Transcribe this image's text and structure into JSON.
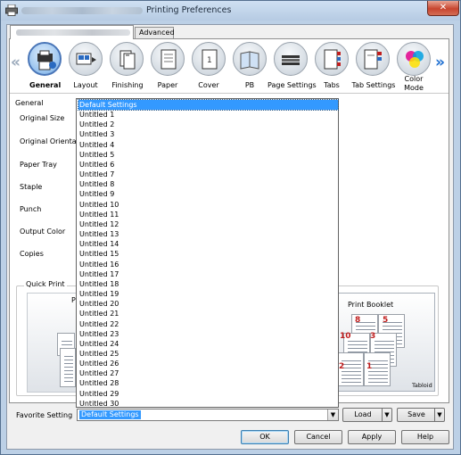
{
  "window": {
    "title": "Printing Preferences",
    "close_label": "✕"
  },
  "tabs": [
    {
      "label": ""
    },
    {
      "label": "Advanced"
    }
  ],
  "nav": {
    "left": "«",
    "right": "»"
  },
  "toolbar": [
    {
      "label": "General",
      "icon": "general-icon"
    },
    {
      "label": "Layout",
      "icon": "layout-icon"
    },
    {
      "label": "Finishing",
      "icon": "finishing-icon"
    },
    {
      "label": "Paper",
      "icon": "paper-icon"
    },
    {
      "label": "Cover",
      "icon": "cover-icon"
    },
    {
      "label": "PB",
      "icon": "pb-icon"
    },
    {
      "label": "Page Settings",
      "icon": "page-settings-icon"
    },
    {
      "label": "Tabs",
      "icon": "tabs-icon"
    },
    {
      "label": "Tab Settings",
      "icon": "tab-settings-icon"
    },
    {
      "label": "Color Mode",
      "label_line1": "Color",
      "label_line2": "Mode",
      "icon": "color-mode-icon"
    }
  ],
  "general": {
    "section": "General",
    "fields": [
      "Original Size",
      "Original Orientation",
      "Paper Tray",
      "Staple",
      "Punch",
      "Output Color",
      "Copies"
    ]
  },
  "quick_print": {
    "label": "Quick Print",
    "left_card_label": "P",
    "booklet_label": "Print Booklet",
    "booklet_size": "Tabloid",
    "page_numbers": [
      "8",
      "5",
      "10",
      "3",
      "2",
      "1"
    ]
  },
  "dropdown": {
    "items": [
      "Default Settings",
      "Untitled 1",
      "Untitled 2",
      "Untitled 3",
      "Untitled 4",
      "Untitled 5",
      "Untitled 6",
      "Untitled 7",
      "Untitled 8",
      "Untitled 9",
      "Untitled 10",
      "Untitled 11",
      "Untitled 12",
      "Untitled 13",
      "Untitled 14",
      "Untitled 15",
      "Untitled 16",
      "Untitled 17",
      "Untitled 18",
      "Untitled 19",
      "Untitled 20",
      "Untitled 21",
      "Untitled 22",
      "Untitled 23",
      "Untitled 24",
      "Untitled 25",
      "Untitled 26",
      "Untitled 27",
      "Untitled 28",
      "Untitled 29",
      "Untitled 30"
    ],
    "selected_index": 0
  },
  "favorite": {
    "label": "Favorite Setting",
    "value": "Default Settings",
    "load_label": "Load",
    "save_label": "Save"
  },
  "buttons": {
    "ok": "OK",
    "cancel": "Cancel",
    "apply": "Apply",
    "help": "Help"
  },
  "colors": {
    "selection": "#3399ff",
    "window_frame": "#bcd0e6",
    "close_button": "#c8452f"
  }
}
